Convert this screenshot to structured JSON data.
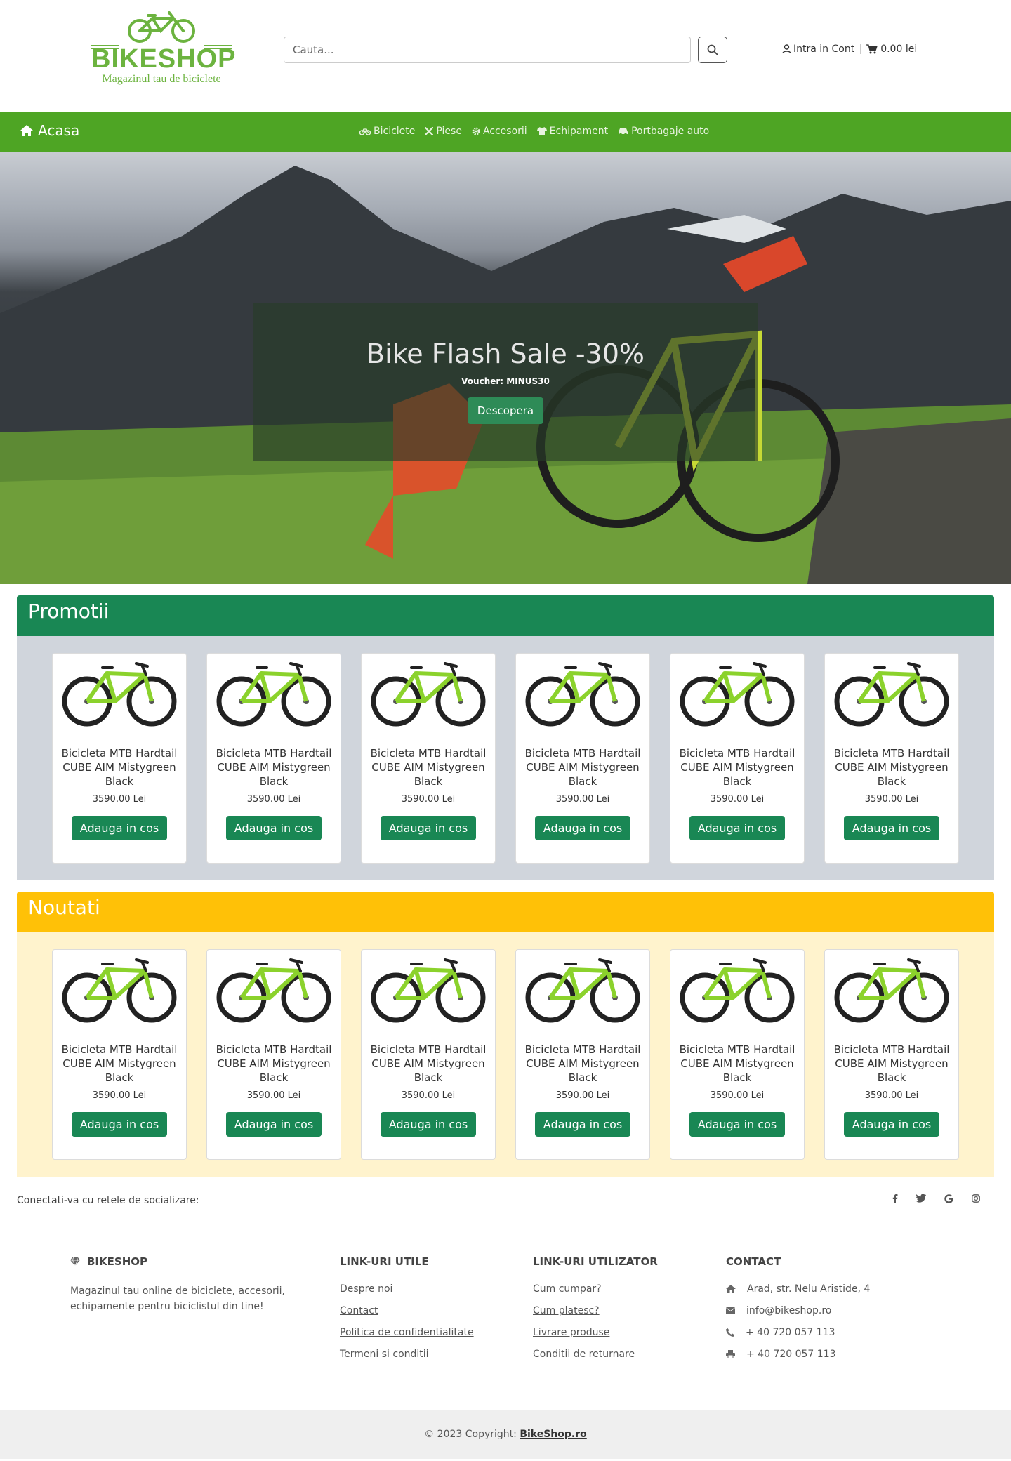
{
  "brand": {
    "name": "BIKESHOP",
    "tagline": "Magazinul tau de biciclete",
    "accent": "#6cb33f"
  },
  "search": {
    "placeholder": "Cauta...",
    "value": ""
  },
  "account": {
    "login": "Intra in Cont",
    "cart_total": "0.00 lei"
  },
  "nav": {
    "home": "Acasa",
    "items": [
      {
        "label": "Biciclete",
        "icon": "bike-icon"
      },
      {
        "label": "Piese",
        "icon": "tools-icon"
      },
      {
        "label": "Accesorii",
        "icon": "gear-icon"
      },
      {
        "label": "Echipament",
        "icon": "shirt-icon"
      },
      {
        "label": "Portbagaje auto",
        "icon": "car-icon"
      }
    ],
    "color": "#4ea524"
  },
  "hero": {
    "title": "Bike Flash Sale -30%",
    "subtitle": "Voucher: MINUS30",
    "button": "Descopera"
  },
  "sections": {
    "promo": {
      "title": "Promotii",
      "color": "#198754",
      "products": [
        {
          "name": "Bicicleta MTB Hardtail CUBE AIM Mistygreen Black",
          "price": "3590.00 Lei",
          "button": "Adauga in cos"
        },
        {
          "name": "Bicicleta MTB Hardtail CUBE AIM Mistygreen Black",
          "price": "3590.00 Lei",
          "button": "Adauga in cos"
        },
        {
          "name": "Bicicleta MTB Hardtail CUBE AIM Mistygreen Black",
          "price": "3590.00 Lei",
          "button": "Adauga in cos"
        },
        {
          "name": "Bicicleta MTB Hardtail CUBE AIM Mistygreen Black",
          "price": "3590.00 Lei",
          "button": "Adauga in cos"
        },
        {
          "name": "Bicicleta MTB Hardtail CUBE AIM Mistygreen Black",
          "price": "3590.00 Lei",
          "button": "Adauga in cos"
        },
        {
          "name": "Bicicleta MTB Hardtail CUBE AIM Mistygreen Black",
          "price": "3590.00 Lei",
          "button": "Adauga in cos"
        }
      ]
    },
    "news": {
      "title": "Noutati",
      "color": "#ffc107",
      "products": [
        {
          "name": "Bicicleta MTB Hardtail CUBE AIM Mistygreen Black",
          "price": "3590.00 Lei",
          "button": "Adauga in cos"
        },
        {
          "name": "Bicicleta MTB Hardtail CUBE AIM Mistygreen Black",
          "price": "3590.00 Lei",
          "button": "Adauga in cos"
        },
        {
          "name": "Bicicleta MTB Hardtail CUBE AIM Mistygreen Black",
          "price": "3590.00 Lei",
          "button": "Adauga in cos"
        },
        {
          "name": "Bicicleta MTB Hardtail CUBE AIM Mistygreen Black",
          "price": "3590.00 Lei",
          "button": "Adauga in cos"
        },
        {
          "name": "Bicicleta MTB Hardtail CUBE AIM Mistygreen Black",
          "price": "3590.00 Lei",
          "button": "Adauga in cos"
        },
        {
          "name": "Bicicleta MTB Hardtail CUBE AIM Mistygreen Black",
          "price": "3590.00 Lei",
          "button": "Adauga in cos"
        }
      ]
    }
  },
  "social": {
    "text": "Conectati-va cu retele de socializare:",
    "icons": [
      "facebook-icon",
      "twitter-icon",
      "google-icon",
      "instagram-icon"
    ]
  },
  "footer": {
    "about": {
      "title": "BIKESHOP",
      "text": "Magazinul tau online de biciclete, accesorii, echipamente pentru biciclistul din tine!"
    },
    "useful": {
      "title": "LINK-URI UTILE",
      "links": [
        "Despre noi",
        "Contact",
        "Politica de confidentialitate",
        "Termeni si conditii"
      ]
    },
    "user": {
      "title": "LINK-URI UTILIZATOR",
      "links": [
        "Cum cumpar?",
        "Cum platesc?",
        "Livrare produse",
        "Conditii de returnare"
      ]
    },
    "contact": {
      "title": "CONTACT",
      "address": "Arad, str. Nelu Aristide, 4",
      "email": "info@bikeshop.ro",
      "phone": "+ 40 720 057 113",
      "fax": "+ 40 720 057 113"
    },
    "copyright_prefix": "© 2023 Copyright: ",
    "copyright_link": "BikeShop.ro"
  }
}
